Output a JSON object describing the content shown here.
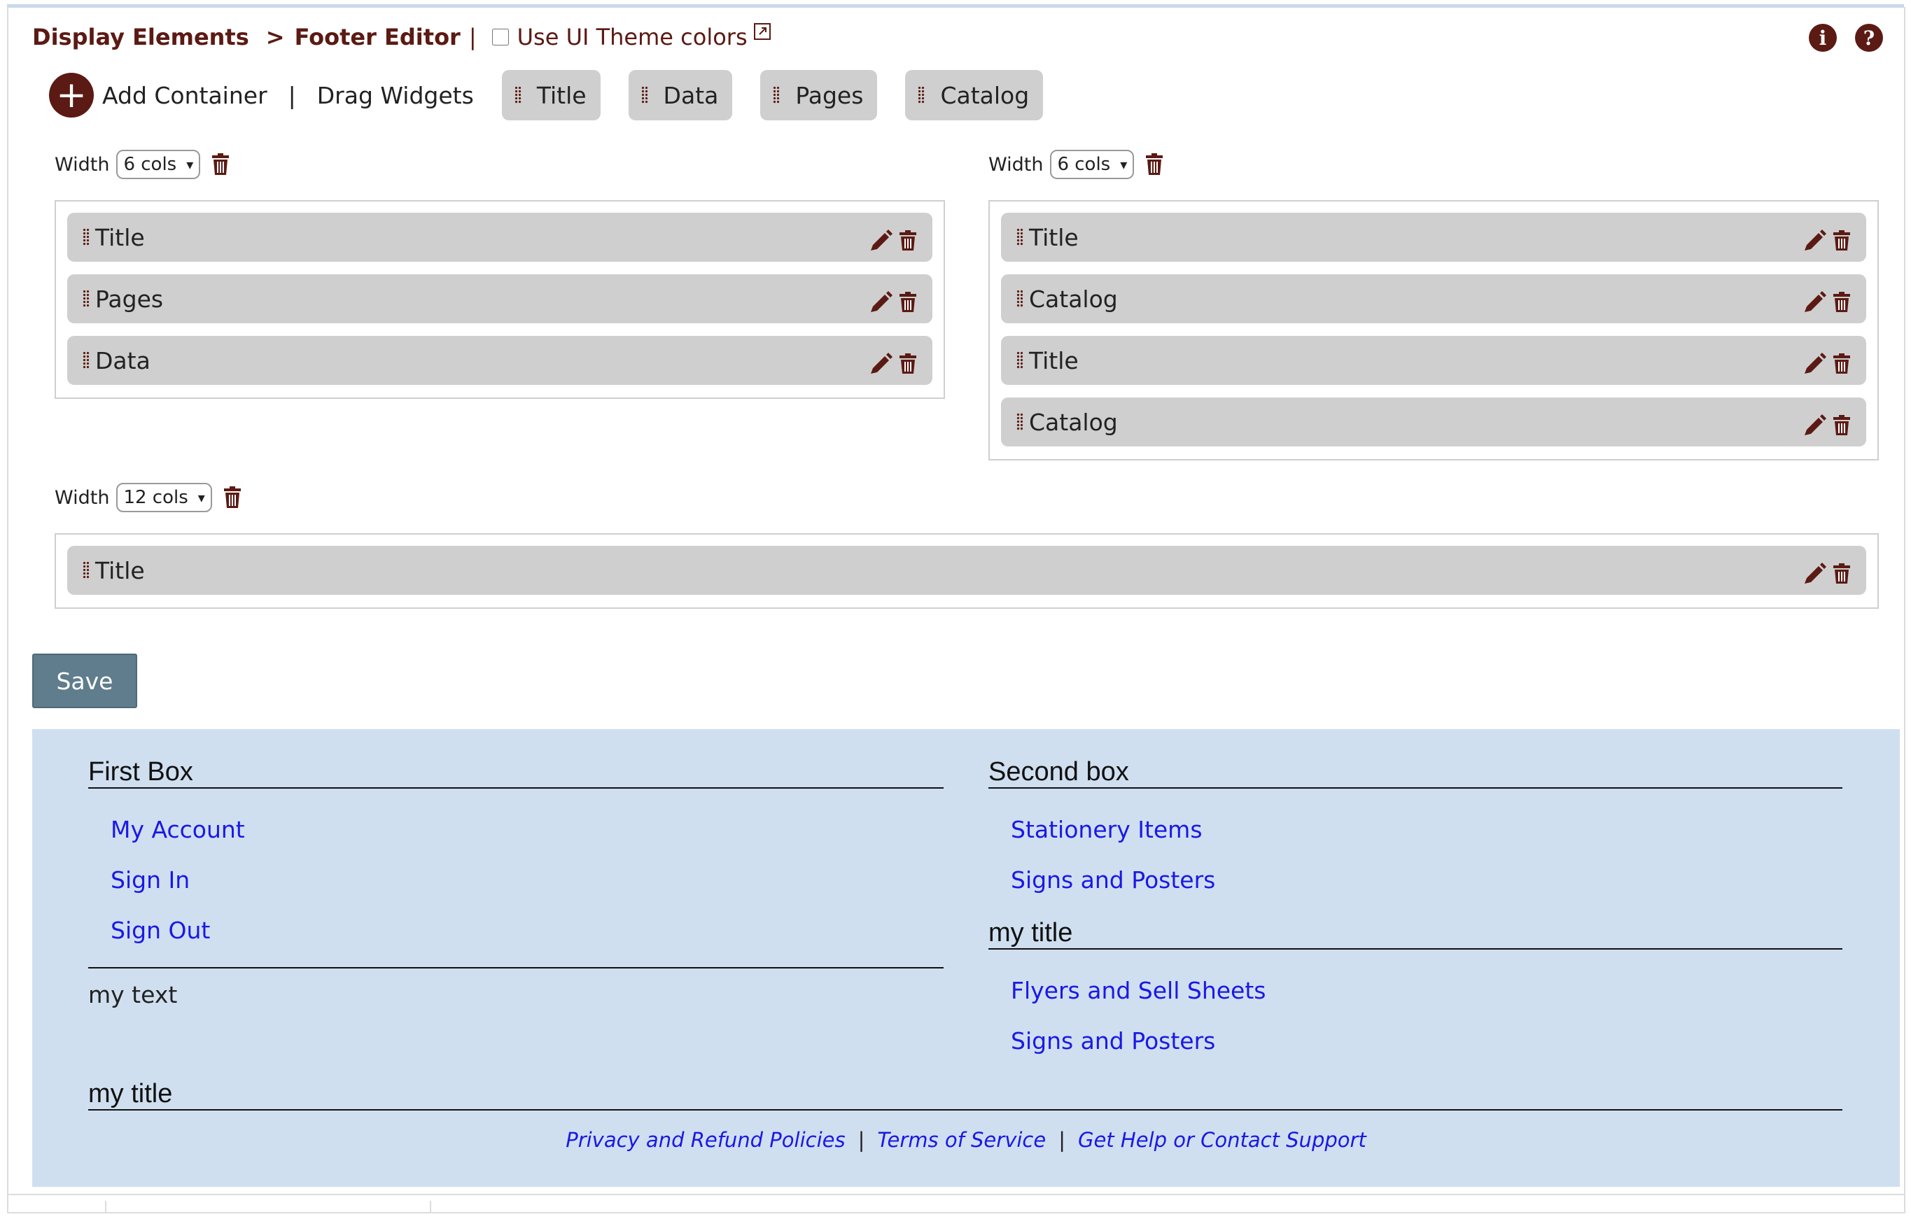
{
  "header": {
    "breadcrumb_root": "Display Elements",
    "breadcrumb_sep": ">",
    "breadcrumb_current": "Footer Editor",
    "pipe": "|",
    "theme_checkbox_label": "Use UI Theme colors",
    "theme_checkbox_checked": false,
    "info_label": "i",
    "help_label": "?"
  },
  "toolbar": {
    "add_icon": "+",
    "add_label": "Add Container",
    "pipe": "|",
    "drag_label": "Drag Widgets",
    "widgets": [
      "Title",
      "Data",
      "Pages",
      "Catalog"
    ]
  },
  "editor": {
    "width_label": "Width",
    "containers": [
      {
        "width": "6 cols",
        "widgets": [
          "Title",
          "Pages",
          "Data"
        ]
      },
      {
        "width": "6 cols",
        "widgets": [
          "Title",
          "Catalog",
          "Title",
          "Catalog"
        ]
      },
      {
        "width": "12 cols",
        "widgets": [
          "Title"
        ]
      }
    ],
    "save_label": "Save"
  },
  "preview": {
    "first_box": {
      "title": "First Box",
      "links": [
        "My Account",
        "Sign In",
        "Sign Out"
      ],
      "text": "my text",
      "title2": "my title"
    },
    "second_box": {
      "title": "Second box",
      "links": [
        "Stationery Items",
        "Signs and Posters"
      ],
      "title2": "my title",
      "links2": [
        "Flyers and Sell Sheets",
        "Signs and Posters"
      ]
    },
    "policies": [
      "Privacy and Refund Policies",
      "Terms of Service",
      "Get Help or Contact Support"
    ],
    "policy_sep": "|"
  },
  "colors": {
    "brand": "#5b1a13",
    "widget_bg": "#cfcfcf",
    "preview_bg": "#cfdff0",
    "link": "#1a18e6",
    "save_bg": "#5f7d8c"
  },
  "icons": {
    "add": "plus-circle-icon",
    "external": "external-link-icon",
    "grip": "drag-handle-icon",
    "edit": "pencil-icon",
    "delete": "trash-icon",
    "info": "info-icon",
    "help": "help-icon"
  }
}
